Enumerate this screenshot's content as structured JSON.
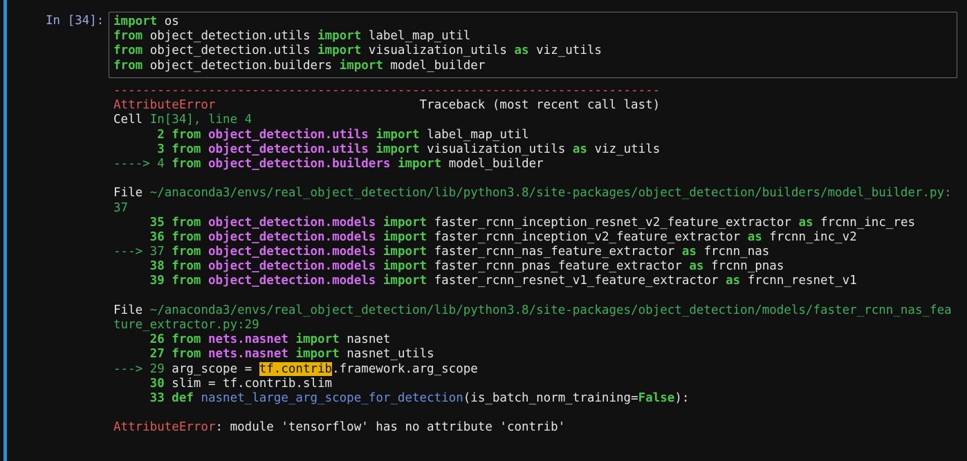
{
  "cell": {
    "prompt": "In [34]:",
    "input_lines": [
      [
        {
          "t": "import",
          "c": "kw"
        },
        {
          "t": " os",
          "c": ""
        }
      ],
      [
        {
          "t": "from",
          "c": "kw"
        },
        {
          "t": " object_detection.utils ",
          "c": ""
        },
        {
          "t": "import",
          "c": "kw"
        },
        {
          "t": " label_map_util",
          "c": ""
        }
      ],
      [
        {
          "t": "from",
          "c": "kw"
        },
        {
          "t": " object_detection.utils ",
          "c": ""
        },
        {
          "t": "import",
          "c": "kw"
        },
        {
          "t": " visualization_utils ",
          "c": ""
        },
        {
          "t": "as",
          "c": "kw"
        },
        {
          "t": " viz_utils",
          "c": ""
        }
      ],
      [
        {
          "t": "from",
          "c": "kw"
        },
        {
          "t": " object_detection.builders ",
          "c": ""
        },
        {
          "t": "import",
          "c": "kw"
        },
        {
          "t": " model_builder",
          "c": ""
        }
      ]
    ]
  },
  "traceback": {
    "lines": [
      [
        {
          "t": "---------------------------------------------------------------------------",
          "c": "dash"
        }
      ],
      [
        {
          "t": "AttributeError",
          "c": "err"
        },
        {
          "t": "                            Traceback (most recent call last)",
          "c": ""
        }
      ],
      [
        {
          "t": "Cell ",
          "c": ""
        },
        {
          "t": "In[34], line 4",
          "c": "gn"
        }
      ],
      [
        {
          "t": "      2 ",
          "c": "gnb"
        },
        {
          "t": "from",
          "c": "kw"
        },
        {
          "t": " ",
          "c": ""
        },
        {
          "t": "object_detection.utils",
          "c": "mod"
        },
        {
          "t": " ",
          "c": ""
        },
        {
          "t": "import",
          "c": "kw"
        },
        {
          "t": " label_map_util",
          "c": ""
        }
      ],
      [
        {
          "t": "      3 ",
          "c": "gnb"
        },
        {
          "t": "from",
          "c": "kw"
        },
        {
          "t": " ",
          "c": ""
        },
        {
          "t": "object_detection.utils",
          "c": "mod"
        },
        {
          "t": " ",
          "c": ""
        },
        {
          "t": "import",
          "c": "kw"
        },
        {
          "t": " visualization_utils ",
          "c": ""
        },
        {
          "t": "as",
          "c": "kw"
        },
        {
          "t": " viz_utils",
          "c": ""
        }
      ],
      [
        {
          "t": "----> 4 ",
          "c": "gn"
        },
        {
          "t": "from",
          "c": "kw"
        },
        {
          "t": " ",
          "c": ""
        },
        {
          "t": "object_detection.builders",
          "c": "mod"
        },
        {
          "t": " ",
          "c": ""
        },
        {
          "t": "import",
          "c": "kw"
        },
        {
          "t": " model_builder",
          "c": ""
        }
      ],
      [
        {
          "t": "",
          "c": ""
        }
      ],
      [
        {
          "t": "File ",
          "c": ""
        },
        {
          "t": "~/anaconda3/envs/real_object_detection/lib/python3.8/site-packages/object_detection/builders/model_builder.py:",
          "c": "gn"
        }
      ],
      [
        {
          "t": "37",
          "c": "gn"
        }
      ],
      [
        {
          "t": "     35 ",
          "c": "gnb"
        },
        {
          "t": "from",
          "c": "kw"
        },
        {
          "t": " ",
          "c": ""
        },
        {
          "t": "object_detection.models",
          "c": "mod"
        },
        {
          "t": " ",
          "c": ""
        },
        {
          "t": "import",
          "c": "kw"
        },
        {
          "t": " faster_rcnn_inception_resnet_v2_feature_extractor ",
          "c": ""
        },
        {
          "t": "as",
          "c": "kw"
        },
        {
          "t": " frcnn_inc_res",
          "c": ""
        }
      ],
      [
        {
          "t": "     36 ",
          "c": "gnb"
        },
        {
          "t": "from",
          "c": "kw"
        },
        {
          "t": " ",
          "c": ""
        },
        {
          "t": "object_detection.models",
          "c": "mod"
        },
        {
          "t": " ",
          "c": ""
        },
        {
          "t": "import",
          "c": "kw"
        },
        {
          "t": " faster_rcnn_inception_v2_feature_extractor ",
          "c": ""
        },
        {
          "t": "as",
          "c": "kw"
        },
        {
          "t": " frcnn_inc_v2",
          "c": ""
        }
      ],
      [
        {
          "t": "---> 37 ",
          "c": "gn"
        },
        {
          "t": "from",
          "c": "kw"
        },
        {
          "t": " ",
          "c": ""
        },
        {
          "t": "object_detection.models",
          "c": "mod"
        },
        {
          "t": " ",
          "c": ""
        },
        {
          "t": "import",
          "c": "kw"
        },
        {
          "t": " faster_rcnn_nas_feature_extractor ",
          "c": ""
        },
        {
          "t": "as",
          "c": "kw"
        },
        {
          "t": " frcnn_nas",
          "c": ""
        }
      ],
      [
        {
          "t": "     38 ",
          "c": "gnb"
        },
        {
          "t": "from",
          "c": "kw"
        },
        {
          "t": " ",
          "c": ""
        },
        {
          "t": "object_detection.models",
          "c": "mod"
        },
        {
          "t": " ",
          "c": ""
        },
        {
          "t": "import",
          "c": "kw"
        },
        {
          "t": " faster_rcnn_pnas_feature_extractor ",
          "c": ""
        },
        {
          "t": "as",
          "c": "kw"
        },
        {
          "t": " frcnn_pnas",
          "c": ""
        }
      ],
      [
        {
          "t": "     39 ",
          "c": "gnb"
        },
        {
          "t": "from",
          "c": "kw"
        },
        {
          "t": " ",
          "c": ""
        },
        {
          "t": "object_detection.models",
          "c": "mod"
        },
        {
          "t": " ",
          "c": ""
        },
        {
          "t": "import",
          "c": "kw"
        },
        {
          "t": " faster_rcnn_resnet_v1_feature_extractor ",
          "c": ""
        },
        {
          "t": "as",
          "c": "kw"
        },
        {
          "t": " frcnn_resnet_v1",
          "c": ""
        }
      ],
      [
        {
          "t": "",
          "c": ""
        }
      ],
      [
        {
          "t": "File ",
          "c": ""
        },
        {
          "t": "~/anaconda3/envs/real_object_detection/lib/python3.8/site-packages/object_detection/models/faster_rcnn_nas_fea",
          "c": "gn"
        }
      ],
      [
        {
          "t": "ture_extractor.py:29",
          "c": "gn"
        }
      ],
      [
        {
          "t": "     26 ",
          "c": "gnb"
        },
        {
          "t": "from",
          "c": "kw"
        },
        {
          "t": " ",
          "c": ""
        },
        {
          "t": "nets.nasnet",
          "c": "mod"
        },
        {
          "t": " ",
          "c": ""
        },
        {
          "t": "import",
          "c": "kw"
        },
        {
          "t": " nasnet",
          "c": ""
        }
      ],
      [
        {
          "t": "     27 ",
          "c": "gnb"
        },
        {
          "t": "from",
          "c": "kw"
        },
        {
          "t": " ",
          "c": ""
        },
        {
          "t": "nets.nasnet",
          "c": "mod"
        },
        {
          "t": " ",
          "c": ""
        },
        {
          "t": "import",
          "c": "kw"
        },
        {
          "t": " nasnet_utils",
          "c": ""
        }
      ],
      [
        {
          "t": "---> 29 ",
          "c": "gn"
        },
        {
          "t": "arg_scope = ",
          "c": ""
        },
        {
          "t": "tf.contrib",
          "c": "hl"
        },
        {
          "t": ".framework.arg_scope",
          "c": ""
        }
      ],
      [
        {
          "t": "     30 ",
          "c": "gnb"
        },
        {
          "t": "slim = tf.contrib.slim",
          "c": ""
        }
      ],
      [
        {
          "t": "     33 ",
          "c": "gnb"
        },
        {
          "t": "def",
          "c": "kw"
        },
        {
          "t": " ",
          "c": ""
        },
        {
          "t": "nasnet_large_arg_scope_for_detection",
          "c": "fname"
        },
        {
          "t": "(is_batch_norm_training=",
          "c": ""
        },
        {
          "t": "False",
          "c": "kw"
        },
        {
          "t": "):",
          "c": ""
        }
      ],
      [
        {
          "t": "",
          "c": ""
        }
      ],
      [
        {
          "t": "AttributeError",
          "c": "err"
        },
        {
          "t": ": module 'tensorflow' has no attribute 'contrib'",
          "c": ""
        }
      ]
    ]
  }
}
